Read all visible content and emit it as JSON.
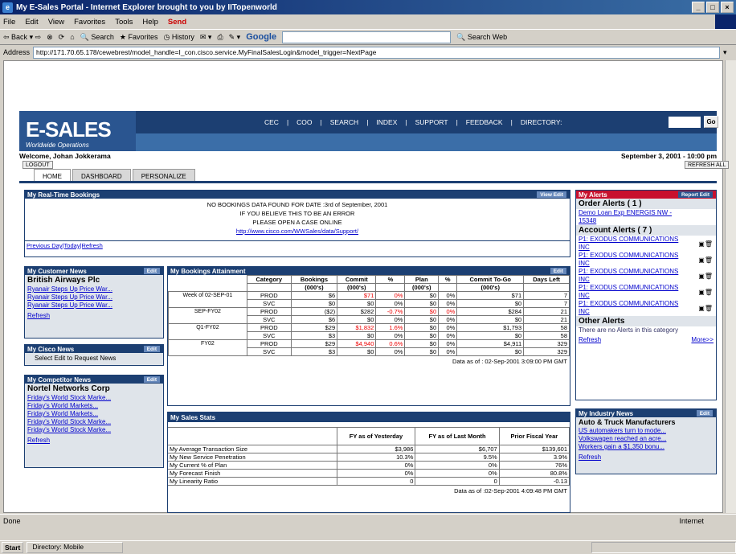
{
  "window": {
    "title": "My E-Sales Portal - Internet Explorer brought to you by IITopenworld"
  },
  "menu": [
    "File",
    "Edit",
    "View",
    "Favorites",
    "Tools",
    "Help",
    "Send"
  ],
  "toolbar": {
    "back": "Back",
    "search": "Search",
    "favorites": "Favorites",
    "history": "History",
    "google": "Google",
    "search_web": "Search Web"
  },
  "address": {
    "label": "Address",
    "url": "http://171.70.65.178/cewebrest/model_handle=I_con.cisco.service.MyFinalSalesLogin&model_trigger=NextPage"
  },
  "header": {
    "logo": "E-SALES",
    "subtitle": "Worldwide Operations",
    "nav": [
      "CEC",
      "|",
      "COO",
      "|",
      "SEARCH",
      "|",
      "INDEX",
      "|",
      "SUPPORT",
      "|",
      "FEEDBACK",
      "|",
      "DIRECTORY:"
    ],
    "go": "Go"
  },
  "welcome": {
    "text": "Welcome, Johan Jokkerama",
    "date": "September 3, 2001 - 10:00 pm",
    "logout": "LOGOUT",
    "refresh": "REFRESH ALL"
  },
  "tabs": [
    "HOME",
    "DASHBOARD",
    "PERSONALIZE"
  ],
  "realtime": {
    "title": "My Real-Time Bookings",
    "edit": "View Edit",
    "line1": "NO BOOKINGS DATA FOUND FOR DATE :3rd of September, 2001",
    "line2": "IF YOU BELIEVE THIS TO BE AN ERROR",
    "line3": "PLEASE OPEN A CASE ONLINE",
    "link": "http://www.cisco.com/WWSales/data/Support/",
    "footer": "Previous Day|Today|Refresh"
  },
  "customer_news": {
    "title": "My Customer News",
    "edit": "Edit",
    "company": "British Airways Plc",
    "items": [
      "Ryanair Steps Up Price War...",
      "Ryanair Steps Up Price War...",
      "Ryanair Steps Up Price War..."
    ],
    "refresh": "Refresh"
  },
  "cisco_news": {
    "title": "My Cisco News",
    "edit": "Edit",
    "text": "Select Edit to Request News"
  },
  "competitor_news": {
    "title": "My Competitor News",
    "edit": "Edit",
    "company": "Nortel Networks Corp",
    "items": [
      "Friday's World Stock Marke...",
      "Friday's World Markets...",
      "Friday's World Markets...",
      "Friday's World Stock Marke...",
      "Friday's World Stock Marke..."
    ],
    "refresh": "Refresh"
  },
  "bookings": {
    "title": "My Bookings Attainment",
    "edit": "Edit",
    "headers": [
      "",
      "Category",
      "Bookings",
      "Commit",
      "%",
      "Plan",
      "%",
      "Commit To-Go",
      "Days Left"
    ],
    "units": [
      "",
      "",
      "(000's)",
      "(000's)",
      "",
      "(000's)",
      "",
      "(000's)",
      ""
    ],
    "rows": [
      [
        "Week of 02-SEP-01",
        "PROD",
        "$6",
        "$71",
        "0%",
        "$0",
        "0%",
        "$71",
        "7"
      ],
      [
        "",
        "SVC",
        "$0",
        "$0",
        "0%",
        "$0",
        "0%",
        "$0",
        "7"
      ],
      [
        "SEP-FY02",
        "PROD",
        "($2)",
        "$282",
        "-0.7%",
        "$0",
        "0%",
        "$284",
        "21"
      ],
      [
        "",
        "SVC",
        "$6",
        "$0",
        "0%",
        "$0",
        "0%",
        "$0",
        "21"
      ],
      [
        "Q1-FY02",
        "PROD",
        "$29",
        "$1,832",
        "1.6%",
        "$0",
        "0%",
        "$1,793",
        "58"
      ],
      [
        "",
        "SVC",
        "$3",
        "$0",
        "0%",
        "$0",
        "0%",
        "$0",
        "58"
      ],
      [
        "FY02",
        "PROD",
        "$29",
        "$4,940",
        "0.6%",
        "$0",
        "0%",
        "$4,911",
        "329"
      ],
      [
        "",
        "SVC",
        "$3",
        "$0",
        "0%",
        "$0",
        "0%",
        "$0",
        "329"
      ]
    ],
    "footer": "Data as of : 02-Sep-2001 3:09:00 PM GMT"
  },
  "sales_stats": {
    "title": "My Sales Stats",
    "headers": [
      "",
      "FY as of Yesterday",
      "FY as of Last Month",
      "Prior Fiscal Year"
    ],
    "rows": [
      [
        "My Average Transaction Size",
        "$3,986",
        "$6,707",
        "$139,601"
      ],
      [
        "My New Service Penetration",
        "10.3%",
        "9.5%",
        "3.9%"
      ],
      [
        "My Current % of Plan",
        "0%",
        "0%",
        "76%"
      ],
      [
        "My Forecast Finish",
        "0%",
        "0%",
        "80.8%"
      ],
      [
        "My Linearity Ratio",
        "0",
        "0",
        "-0.13"
      ]
    ],
    "footer": "Data as of :02-Sep-2001 4:09:48 PM GMT"
  },
  "alerts": {
    "title": "My Alerts",
    "edit": "Report Edit",
    "order_head": "Order Alerts ( 1 )",
    "order_item": "Demo Loan Exp ENERGIS NW - 15348",
    "account_head": "Account Alerts ( 7 )",
    "account_items": [
      "P1: EXODUS COMMUNICATIONS INC",
      "P1: EXODUS COMMUNICATIONS INC",
      "P1: EXODUS COMMUNICATIONS INC",
      "P1: EXODUS COMMUNICATIONS INC",
      "P1: EXODUS COMMUNICATIONS INC"
    ],
    "other_head": "Other Alerts",
    "other_text": "There are no Alerts in this category",
    "refresh": "Refresh",
    "more": "More>>"
  },
  "industry_news": {
    "title": "My Industry News",
    "edit": "Edit",
    "company": "Auto & Truck Manufacturers",
    "items": [
      "US automakers turn to mode...",
      "Volkswagen reached an acre...",
      "Workers gain a $1,350 bonu..."
    ],
    "refresh": "Refresh"
  },
  "status": {
    "left": "Done",
    "right": "Internet"
  },
  "taskbar": {
    "start": "Start",
    "task": "Directory: Mobile"
  }
}
